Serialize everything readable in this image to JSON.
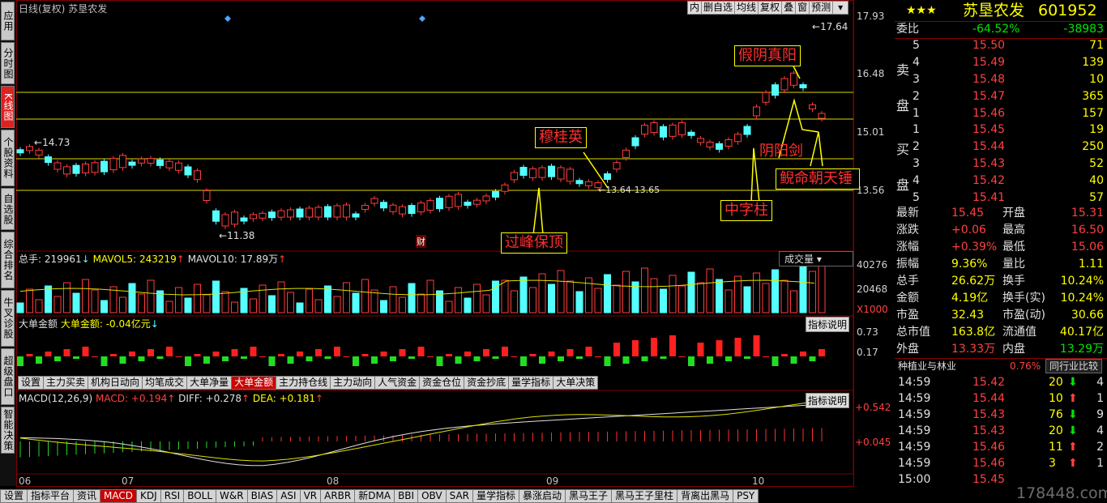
{
  "side_tabs": [
    "应用",
    "分时图",
    "K线图",
    "个股资料",
    "自选股",
    "综合排名",
    "牛叉诊股",
    "超级盘口",
    "智能决策"
  ],
  "chart_header": {
    "title": "日线(复权)",
    "stock": "苏垦农发"
  },
  "top_toolbar": [
    "内",
    "删自选",
    "均线",
    "复权",
    "叠",
    "窗",
    "预测"
  ],
  "price_axis": [
    "17.93",
    "16.48",
    "15.01",
    "13.56"
  ],
  "price_annotations": {
    "high": "17.64",
    "prev_high": "14.73",
    "low": "11.38",
    "range": "13.64-13.65"
  },
  "cai_marker": "财",
  "volume_header": {
    "total": "总手: 219961",
    "mavol5": "MAVOL5: 243219",
    "mavol10": "MAVOL10: 17.89万"
  },
  "volume_axis": [
    "40276",
    "20468",
    "X1000"
  ],
  "volume_dropdown": "成交量",
  "bigorder_header": {
    "name": "大单金额",
    "value": "大单金额: -0.04亿元"
  },
  "bigorder_axis": [
    "0.73",
    "0.17"
  ],
  "indicator_btn": "指标说明",
  "panel_tabs": [
    "设置",
    "主力买卖",
    "机构日动向",
    "均笔成交",
    "大单净量",
    "大单金额",
    "主力持仓线",
    "主力动向",
    "人气资金",
    "资金仓位",
    "资金抄底",
    "量学指标",
    "大单决策"
  ],
  "panel_tab_active": 5,
  "macd_header": {
    "name": "MACD(12,26,9)",
    "macd": "MACD: +0.194",
    "diff": "DIFF: +0.278",
    "dea": "DEA: +0.181"
  },
  "macd_axis": [
    "+0.542",
    "+0.045"
  ],
  "months": [
    "06",
    "07",
    "08",
    "09",
    "10"
  ],
  "annotations": [
    "穆桂英",
    "过峰保顶",
    "假阴真阳",
    "阴阳剑",
    "中字柱",
    "鲵命朝天锤"
  ],
  "bottom_tabs": [
    "设置",
    "指标平台",
    "资讯",
    "MACD",
    "KDJ",
    "RSI",
    "BOLL",
    "W&R",
    "BIAS",
    "ASI",
    "VR",
    "ARBR",
    "新DMA",
    "BBI",
    "OBV",
    "SAR",
    "量学指标",
    "暴涨启动",
    "黑马王子",
    "黑马王子里柱",
    "背离出黑马",
    "PSY"
  ],
  "bottom_tab_active": 3,
  "quote": {
    "stars": "★★★",
    "name": "苏垦农发",
    "code": "601952",
    "weibi_label": "委比",
    "weibi": "-64.52%",
    "weicha": "-38983",
    "sell_label": [
      "卖",
      "盘"
    ],
    "buy_label": [
      "买",
      "盘"
    ],
    "sell": [
      {
        "lv": "5",
        "price": "15.50",
        "vol": "71"
      },
      {
        "lv": "4",
        "price": "15.49",
        "vol": "139"
      },
      {
        "lv": "3",
        "price": "15.48",
        "vol": "10"
      },
      {
        "lv": "2",
        "price": "15.47",
        "vol": "365"
      },
      {
        "lv": "1",
        "price": "15.46",
        "vol": "157"
      }
    ],
    "buy": [
      {
        "lv": "1",
        "price": "15.45",
        "vol": "19"
      },
      {
        "lv": "2",
        "price": "15.44",
        "vol": "250"
      },
      {
        "lv": "3",
        "price": "15.43",
        "vol": "52"
      },
      {
        "lv": "4",
        "price": "15.42",
        "vol": "40"
      },
      {
        "lv": "5",
        "price": "15.41",
        "vol": "57"
      }
    ],
    "stats": [
      {
        "k1": "最新",
        "v1": "15.45",
        "k2": "开盘",
        "v2": "15.31"
      },
      {
        "k1": "涨跌",
        "v1": "+0.06",
        "k2": "最高",
        "v2": "16.50"
      },
      {
        "k1": "涨幅",
        "v1": "+0.39%",
        "k2": "最低",
        "v2": "15.06"
      },
      {
        "k1": "振幅",
        "v1": "9.36%",
        "k2": "量比",
        "v2": "1.11"
      },
      {
        "k1": "总手",
        "v1": "26.62万",
        "k2": "换手",
        "v2": "10.24%"
      },
      {
        "k1": "金额",
        "v1": "4.19亿",
        "k2": "换手(实)",
        "v2": "10.24%"
      },
      {
        "k1": "市盈",
        "v1": "32.43",
        "k2": "市盈(动)",
        "v2": "30.66"
      },
      {
        "k1": "总市值",
        "v1": "163.8亿",
        "k2": "流通值",
        "v2": "40.17亿"
      },
      {
        "k1": "外盘",
        "v1": "13.33万",
        "k2": "内盘",
        "v2": "13.29万"
      }
    ],
    "industry": "种植业与林业",
    "industry_pct": "0.76%",
    "industry_btn": "同行业比较",
    "ticks": [
      {
        "t": "14:59",
        "p": "15.42",
        "v": "20",
        "d": "down",
        "n": "4"
      },
      {
        "t": "14:59",
        "p": "15.44",
        "v": "10",
        "d": "up",
        "n": "1"
      },
      {
        "t": "14:59",
        "p": "15.43",
        "v": "76",
        "d": "down",
        "n": "9"
      },
      {
        "t": "14:59",
        "p": "15.43",
        "v": "20",
        "d": "down",
        "n": "4"
      },
      {
        "t": "14:59",
        "p": "15.46",
        "v": "11",
        "d": "up",
        "n": "2"
      },
      {
        "t": "14:59",
        "p": "15.46",
        "v": "3",
        "d": "up",
        "n": "1"
      },
      {
        "t": "15:00",
        "p": "15.45",
        "v": "",
        "d": "",
        "n": ""
      }
    ],
    "watermark": "178448.com"
  }
}
